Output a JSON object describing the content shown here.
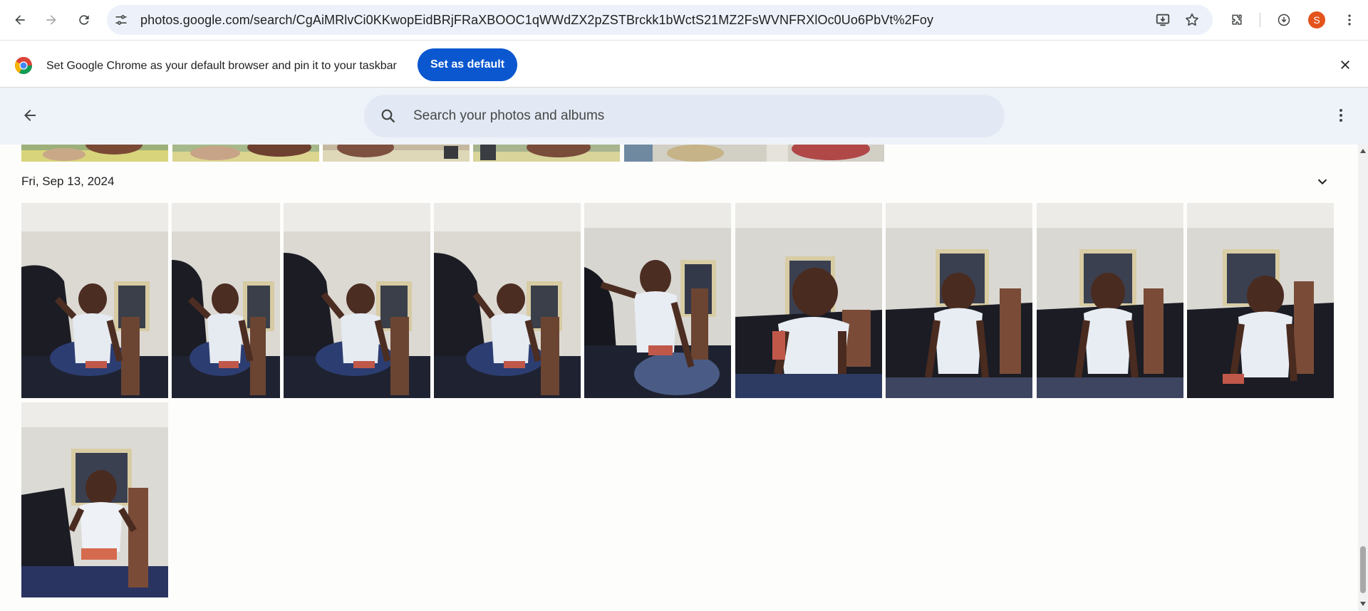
{
  "browser": {
    "url": "photos.google.com/search/CgAiMRlvCi0KKwopEidBRjFRaXBOOC1qWWdZX2pZSTBrckk1bWctS21MZ2FsWVNFRXlOc0Uo6PbVt%2Foy",
    "profile_initial": "S",
    "icons": {
      "back": "arrow-left-icon",
      "forward": "arrow-right-icon",
      "reload": "reload-icon",
      "site_info": "tune-icon",
      "install": "install-app-icon",
      "bookmark": "star-icon",
      "extensions": "puzzle-icon",
      "downloads": "download-icon",
      "menu": "more-vert-icon"
    }
  },
  "infobar": {
    "message": "Set Google Chrome as your default browser and pin it to your taskbar",
    "button_label": "Set as default"
  },
  "photos_header": {
    "search_placeholder": "Search your photos and albums"
  },
  "section": {
    "date": "Fri, Sep 13, 2024",
    "photo_count": 10
  },
  "colors": {
    "accent": "#0b57d0",
    "header_bg": "#eef2f9",
    "search_bg": "#e3e9f4",
    "avatar": "#e3541c"
  }
}
